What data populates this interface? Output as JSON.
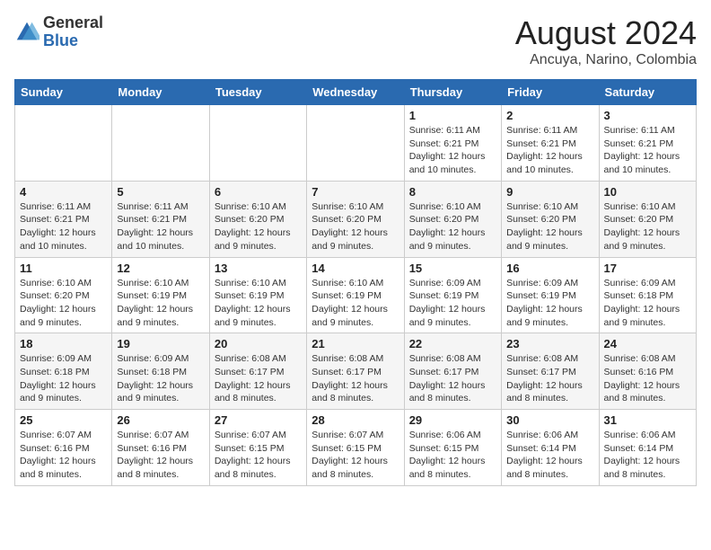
{
  "header": {
    "logo_general": "General",
    "logo_blue": "Blue",
    "main_title": "August 2024",
    "subtitle": "Ancuya, Narino, Colombia"
  },
  "days_of_week": [
    "Sunday",
    "Monday",
    "Tuesday",
    "Wednesday",
    "Thursday",
    "Friday",
    "Saturday"
  ],
  "weeks": [
    [
      {
        "day": "",
        "info": ""
      },
      {
        "day": "",
        "info": ""
      },
      {
        "day": "",
        "info": ""
      },
      {
        "day": "",
        "info": ""
      },
      {
        "day": "1",
        "info": "Sunrise: 6:11 AM\nSunset: 6:21 PM\nDaylight: 12 hours and 10 minutes."
      },
      {
        "day": "2",
        "info": "Sunrise: 6:11 AM\nSunset: 6:21 PM\nDaylight: 12 hours and 10 minutes."
      },
      {
        "day": "3",
        "info": "Sunrise: 6:11 AM\nSunset: 6:21 PM\nDaylight: 12 hours and 10 minutes."
      }
    ],
    [
      {
        "day": "4",
        "info": "Sunrise: 6:11 AM\nSunset: 6:21 PM\nDaylight: 12 hours and 10 minutes."
      },
      {
        "day": "5",
        "info": "Sunrise: 6:11 AM\nSunset: 6:21 PM\nDaylight: 12 hours and 10 minutes."
      },
      {
        "day": "6",
        "info": "Sunrise: 6:10 AM\nSunset: 6:20 PM\nDaylight: 12 hours and 9 minutes."
      },
      {
        "day": "7",
        "info": "Sunrise: 6:10 AM\nSunset: 6:20 PM\nDaylight: 12 hours and 9 minutes."
      },
      {
        "day": "8",
        "info": "Sunrise: 6:10 AM\nSunset: 6:20 PM\nDaylight: 12 hours and 9 minutes."
      },
      {
        "day": "9",
        "info": "Sunrise: 6:10 AM\nSunset: 6:20 PM\nDaylight: 12 hours and 9 minutes."
      },
      {
        "day": "10",
        "info": "Sunrise: 6:10 AM\nSunset: 6:20 PM\nDaylight: 12 hours and 9 minutes."
      }
    ],
    [
      {
        "day": "11",
        "info": "Sunrise: 6:10 AM\nSunset: 6:20 PM\nDaylight: 12 hours and 9 minutes."
      },
      {
        "day": "12",
        "info": "Sunrise: 6:10 AM\nSunset: 6:19 PM\nDaylight: 12 hours and 9 minutes."
      },
      {
        "day": "13",
        "info": "Sunrise: 6:10 AM\nSunset: 6:19 PM\nDaylight: 12 hours and 9 minutes."
      },
      {
        "day": "14",
        "info": "Sunrise: 6:10 AM\nSunset: 6:19 PM\nDaylight: 12 hours and 9 minutes."
      },
      {
        "day": "15",
        "info": "Sunrise: 6:09 AM\nSunset: 6:19 PM\nDaylight: 12 hours and 9 minutes."
      },
      {
        "day": "16",
        "info": "Sunrise: 6:09 AM\nSunset: 6:19 PM\nDaylight: 12 hours and 9 minutes."
      },
      {
        "day": "17",
        "info": "Sunrise: 6:09 AM\nSunset: 6:18 PM\nDaylight: 12 hours and 9 minutes."
      }
    ],
    [
      {
        "day": "18",
        "info": "Sunrise: 6:09 AM\nSunset: 6:18 PM\nDaylight: 12 hours and 9 minutes."
      },
      {
        "day": "19",
        "info": "Sunrise: 6:09 AM\nSunset: 6:18 PM\nDaylight: 12 hours and 9 minutes."
      },
      {
        "day": "20",
        "info": "Sunrise: 6:08 AM\nSunset: 6:17 PM\nDaylight: 12 hours and 8 minutes."
      },
      {
        "day": "21",
        "info": "Sunrise: 6:08 AM\nSunset: 6:17 PM\nDaylight: 12 hours and 8 minutes."
      },
      {
        "day": "22",
        "info": "Sunrise: 6:08 AM\nSunset: 6:17 PM\nDaylight: 12 hours and 8 minutes."
      },
      {
        "day": "23",
        "info": "Sunrise: 6:08 AM\nSunset: 6:17 PM\nDaylight: 12 hours and 8 minutes."
      },
      {
        "day": "24",
        "info": "Sunrise: 6:08 AM\nSunset: 6:16 PM\nDaylight: 12 hours and 8 minutes."
      }
    ],
    [
      {
        "day": "25",
        "info": "Sunrise: 6:07 AM\nSunset: 6:16 PM\nDaylight: 12 hours and 8 minutes."
      },
      {
        "day": "26",
        "info": "Sunrise: 6:07 AM\nSunset: 6:16 PM\nDaylight: 12 hours and 8 minutes."
      },
      {
        "day": "27",
        "info": "Sunrise: 6:07 AM\nSunset: 6:15 PM\nDaylight: 12 hours and 8 minutes."
      },
      {
        "day": "28",
        "info": "Sunrise: 6:07 AM\nSunset: 6:15 PM\nDaylight: 12 hours and 8 minutes."
      },
      {
        "day": "29",
        "info": "Sunrise: 6:06 AM\nSunset: 6:15 PM\nDaylight: 12 hours and 8 minutes."
      },
      {
        "day": "30",
        "info": "Sunrise: 6:06 AM\nSunset: 6:14 PM\nDaylight: 12 hours and 8 minutes."
      },
      {
        "day": "31",
        "info": "Sunrise: 6:06 AM\nSunset: 6:14 PM\nDaylight: 12 hours and 8 minutes."
      }
    ]
  ]
}
